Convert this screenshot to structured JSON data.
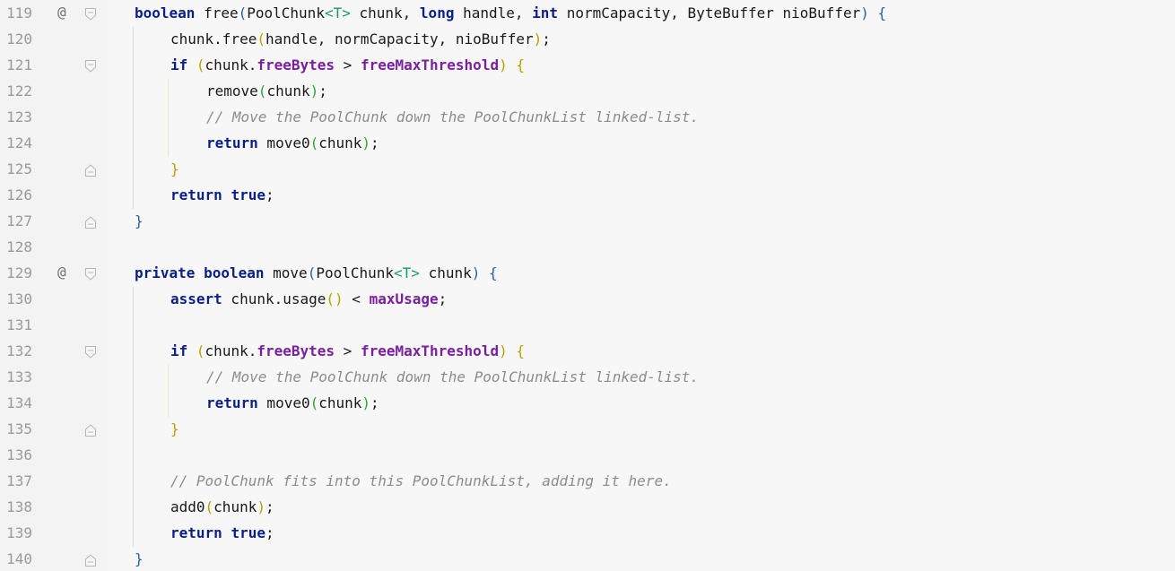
{
  "editor": {
    "lines": [
      {
        "num": "119",
        "marker": "@",
        "tokens": [
          {
            "t": "boolean",
            "c": "kw"
          },
          {
            "t": " free",
            "c": ""
          },
          {
            "t": "(",
            "c": "p1"
          },
          {
            "t": "PoolChunk",
            "c": ""
          },
          {
            "t": "<T>",
            "c": "tp"
          },
          {
            "t": " chunk, ",
            "c": ""
          },
          {
            "t": "long",
            "c": "kw"
          },
          {
            "t": " handle, ",
            "c": ""
          },
          {
            "t": "int",
            "c": "kw"
          },
          {
            "t": " normCapacity, ByteBuffer nioBuffer",
            "c": ""
          },
          {
            "t": ")",
            "c": "p1"
          },
          {
            "t": " ",
            "c": ""
          },
          {
            "t": "{",
            "c": "p1"
          }
        ]
      },
      {
        "num": "120",
        "marker": "",
        "tokens": [
          {
            "t": "chunk.free",
            "c": ""
          },
          {
            "t": "(",
            "c": "p2"
          },
          {
            "t": "handle, normCapacity, nioBuffer",
            "c": ""
          },
          {
            "t": ")",
            "c": "p2"
          },
          {
            "t": ";",
            "c": ""
          }
        ]
      },
      {
        "num": "121",
        "marker": "",
        "tokens": [
          {
            "t": "if",
            "c": "kw"
          },
          {
            "t": " ",
            "c": ""
          },
          {
            "t": "(",
            "c": "p2"
          },
          {
            "t": "chunk.",
            "c": ""
          },
          {
            "t": "freeBytes",
            "c": "fld"
          },
          {
            "t": " > ",
            "c": ""
          },
          {
            "t": "freeMaxThreshold",
            "c": "fld"
          },
          {
            "t": ")",
            "c": "p2"
          },
          {
            "t": " ",
            "c": ""
          },
          {
            "t": "{",
            "c": "p2"
          }
        ]
      },
      {
        "num": "122",
        "marker": "",
        "tokens": [
          {
            "t": "remove",
            "c": ""
          },
          {
            "t": "(",
            "c": "p3"
          },
          {
            "t": "chunk",
            "c": ""
          },
          {
            "t": ")",
            "c": "p3"
          },
          {
            "t": ";",
            "c": ""
          }
        ]
      },
      {
        "num": "123",
        "marker": "",
        "tokens": [
          {
            "t": "// Move the PoolChunk down the PoolChunkList linked-list.",
            "c": "cm"
          }
        ]
      },
      {
        "num": "124",
        "marker": "",
        "tokens": [
          {
            "t": "return",
            "c": "kw"
          },
          {
            "t": " move0",
            "c": ""
          },
          {
            "t": "(",
            "c": "p3"
          },
          {
            "t": "chunk",
            "c": ""
          },
          {
            "t": ")",
            "c": "p3"
          },
          {
            "t": ";",
            "c": ""
          }
        ]
      },
      {
        "num": "125",
        "marker": "",
        "tokens": [
          {
            "t": "}",
            "c": "p2"
          }
        ]
      },
      {
        "num": "126",
        "marker": "",
        "tokens": [
          {
            "t": "return",
            "c": "kw"
          },
          {
            "t": " ",
            "c": ""
          },
          {
            "t": "true",
            "c": "kw"
          },
          {
            "t": ";",
            "c": ""
          }
        ]
      },
      {
        "num": "127",
        "marker": "",
        "tokens": [
          {
            "t": "}",
            "c": "p1"
          }
        ]
      },
      {
        "num": "128",
        "marker": "",
        "tokens": []
      },
      {
        "num": "129",
        "marker": "@",
        "tokens": [
          {
            "t": "private",
            "c": "kw"
          },
          {
            "t": " ",
            "c": ""
          },
          {
            "t": "boolean",
            "c": "kw"
          },
          {
            "t": " move",
            "c": ""
          },
          {
            "t": "(",
            "c": "p1"
          },
          {
            "t": "PoolChunk",
            "c": ""
          },
          {
            "t": "<T>",
            "c": "tp"
          },
          {
            "t": " chunk",
            "c": ""
          },
          {
            "t": ")",
            "c": "p1"
          },
          {
            "t": " ",
            "c": ""
          },
          {
            "t": "{",
            "c": "p1"
          }
        ]
      },
      {
        "num": "130",
        "marker": "",
        "tokens": [
          {
            "t": "assert",
            "c": "kw"
          },
          {
            "t": " chunk.usage",
            "c": ""
          },
          {
            "t": "()",
            "c": "p2"
          },
          {
            "t": " < ",
            "c": ""
          },
          {
            "t": "maxUsage",
            "c": "fld"
          },
          {
            "t": ";",
            "c": ""
          }
        ]
      },
      {
        "num": "131",
        "marker": "",
        "tokens": []
      },
      {
        "num": "132",
        "marker": "",
        "tokens": [
          {
            "t": "if",
            "c": "kw"
          },
          {
            "t": " ",
            "c": ""
          },
          {
            "t": "(",
            "c": "p2"
          },
          {
            "t": "chunk.",
            "c": ""
          },
          {
            "t": "freeBytes",
            "c": "fld"
          },
          {
            "t": " > ",
            "c": ""
          },
          {
            "t": "freeMaxThreshold",
            "c": "fld"
          },
          {
            "t": ")",
            "c": "p2"
          },
          {
            "t": " ",
            "c": ""
          },
          {
            "t": "{",
            "c": "p2"
          }
        ]
      },
      {
        "num": "133",
        "marker": "",
        "tokens": [
          {
            "t": "// Move the PoolChunk down the PoolChunkList linked-list.",
            "c": "cm"
          }
        ]
      },
      {
        "num": "134",
        "marker": "",
        "tokens": [
          {
            "t": "return",
            "c": "kw"
          },
          {
            "t": " move0",
            "c": ""
          },
          {
            "t": "(",
            "c": "p3"
          },
          {
            "t": "chunk",
            "c": ""
          },
          {
            "t": ")",
            "c": "p3"
          },
          {
            "t": ";",
            "c": ""
          }
        ]
      },
      {
        "num": "135",
        "marker": "",
        "tokens": [
          {
            "t": "}",
            "c": "p2"
          }
        ]
      },
      {
        "num": "136",
        "marker": "",
        "tokens": []
      },
      {
        "num": "137",
        "marker": "",
        "tokens": [
          {
            "t": "// PoolChunk fits into this PoolChunkList, adding it here.",
            "c": "cm"
          }
        ]
      },
      {
        "num": "138",
        "marker": "",
        "tokens": [
          {
            "t": "add0",
            "c": ""
          },
          {
            "t": "(",
            "c": "p2"
          },
          {
            "t": "chunk",
            "c": ""
          },
          {
            "t": ")",
            "c": "p2"
          },
          {
            "t": ";",
            "c": ""
          }
        ]
      },
      {
        "num": "139",
        "marker": "",
        "tokens": [
          {
            "t": "return",
            "c": "kw"
          },
          {
            "t": " ",
            "c": ""
          },
          {
            "t": "true",
            "c": "kw"
          },
          {
            "t": ";",
            "c": ""
          }
        ]
      },
      {
        "num": "140",
        "marker": "",
        "tokens": [
          {
            "t": "}",
            "c": "p1"
          }
        ]
      }
    ]
  }
}
